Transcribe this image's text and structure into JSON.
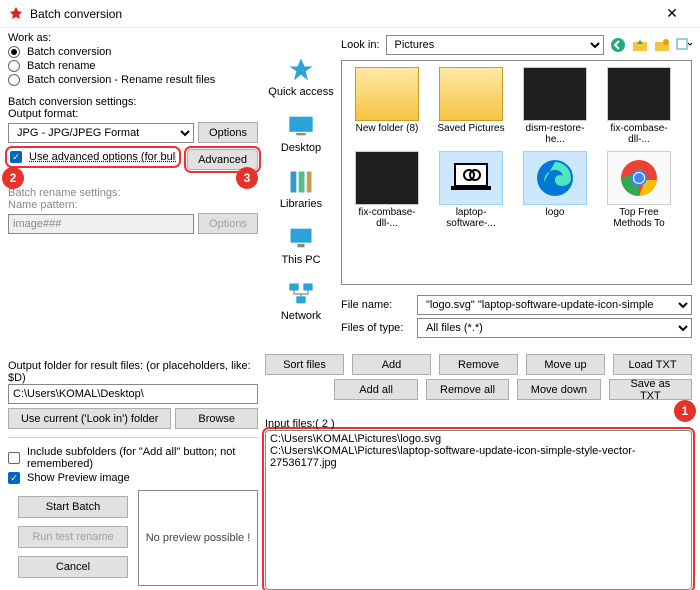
{
  "window": {
    "title": "Batch conversion"
  },
  "workas": {
    "label": "Work as:",
    "batch": "Batch conversion",
    "rename": "Batch rename",
    "both": "Batch conversion - Rename result files"
  },
  "bcs": {
    "header": "Batch conversion settings:",
    "output_label": "Output format:",
    "output_value": "JPG - JPG/JPEG Format",
    "options_btn": "Options",
    "adv_check": "Use advanced options (for bulk resize...)",
    "advanced_btn": "Advanced"
  },
  "brs": {
    "header": "Batch rename settings:",
    "pattern_label": "Name pattern:",
    "pattern_value": "image###",
    "options_btn": "Options"
  },
  "outfolder": {
    "label": "Output folder for result files: (or placeholders, like: $D)",
    "value": "C:\\Users\\KOMAL\\Desktop\\",
    "use_current": "Use current ('Look in') folder",
    "browse": "Browse"
  },
  "opts": {
    "subfolders": "Include subfolders (for \"Add all\" button; not remembered)",
    "preview": "Show Preview image"
  },
  "actions": {
    "start": "Start Batch",
    "test": "Run test rename",
    "cancel": "Cancel"
  },
  "preview_msg": "No preview possible !",
  "lookin": {
    "label": "Look in:",
    "value": "Pictures"
  },
  "places": {
    "quick": "Quick access",
    "desktop": "Desktop",
    "libraries": "Libraries",
    "thispc": "This PC",
    "network": "Network"
  },
  "files": [
    {
      "label": "New folder (8)",
      "type": "folder"
    },
    {
      "label": "Saved Pictures",
      "type": "folder"
    },
    {
      "label": "dism-restore-he...",
      "type": "dark"
    },
    {
      "label": "fix-combase-dll-...",
      "type": "dark"
    },
    {
      "label": "fix-combase-dll-...",
      "type": "dark"
    },
    {
      "label": "laptop-software-...",
      "type": "laptop",
      "sel": true
    },
    {
      "label": "logo",
      "type": "edge",
      "sel": true
    },
    {
      "label": "Top Free Methods To Convert PST ...",
      "type": "chrome"
    }
  ],
  "filefields": {
    "name_label": "File name:",
    "name_value": "\"logo.svg\" \"laptop-software-update-icon-simple",
    "type_label": "Files of type:",
    "type_value": "All files (*.*)"
  },
  "filebtns": {
    "sort": "Sort files",
    "add": "Add",
    "remove": "Remove",
    "moveup": "Move up",
    "loadtxt": "Load TXT",
    "addall": "Add all",
    "removeall": "Remove all",
    "movedown": "Move down",
    "savetxt": "Save as TXT"
  },
  "inputfiles": {
    "label": "Input files:( 2 )",
    "items": [
      "C:\\Users\\KOMAL\\Pictures\\logo.svg",
      "C:\\Users\\KOMAL\\Pictures\\laptop-software-update-icon-simple-style-vector-27536177.jpg"
    ]
  },
  "callouts": {
    "c1": "1",
    "c2": "2",
    "c3": "3"
  }
}
